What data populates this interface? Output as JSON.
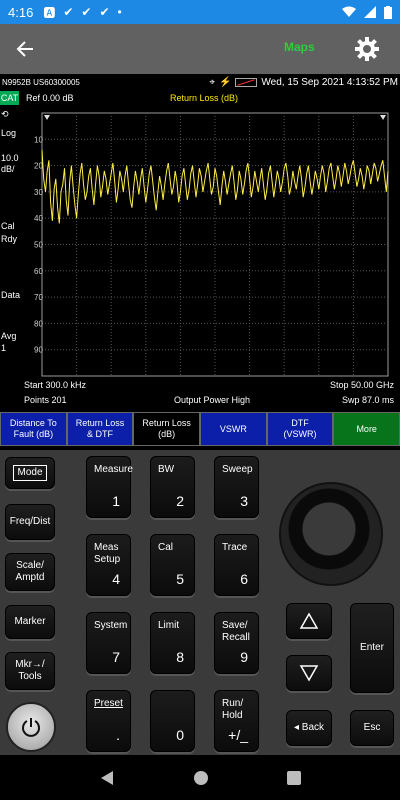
{
  "status_bar": {
    "time": "4:16",
    "icons": [
      "a-badge-icon",
      "check-icon",
      "check-icon",
      "check-icon",
      "dot-icon"
    ]
  },
  "app_bar": {
    "maps_label": "Maps"
  },
  "instrument": {
    "model": "N9952B US60300005",
    "datetime": "Wed, 15 Sep 2021 4:13:52 PM",
    "left": {
      "cat": "CAT",
      "log": "Log",
      "scale_value": "10.0",
      "scale_unit": "dB/",
      "cal": "Cal",
      "rdy": "Rdy",
      "data": "Data",
      "avg": "Avg",
      "avg_count": "1"
    },
    "ref_label": "Ref 0.00 dB",
    "trace_title": "Return Loss (dB)",
    "y_ticks": [
      "10",
      "20",
      "30",
      "40",
      "50",
      "60",
      "70",
      "80",
      "90"
    ],
    "start": "Start 300.0 kHz",
    "stop": "Stop 50.00 GHz",
    "points": "Points 201",
    "output_power": "Output Power High",
    "sweep_time": "Swp 87.0 ms"
  },
  "softkeys": [
    {
      "line1": "Distance To",
      "line2": "Fault (dB)"
    },
    {
      "line1": "Return Loss",
      "line2": "& DTF"
    },
    {
      "line1": "Return Loss",
      "line2": "(dB)"
    },
    {
      "line1": "VSWR",
      "line2": ""
    },
    {
      "line1": "DTF",
      "line2": "(VSWR)"
    },
    {
      "line1": "More",
      "line2": ""
    }
  ],
  "keys": {
    "mode": "Mode",
    "freq_dist": "Freq/Dist",
    "scale_amptd_1": "Scale/",
    "scale_amptd_2": "Amptd",
    "marker": "Marker",
    "mkr_tools_1": "Mkr→/",
    "mkr_tools_2": "Tools",
    "measure": "Measure",
    "bw": "BW",
    "sweep": "Sweep",
    "meas_setup_1": "Meas",
    "meas_setup_2": "Setup",
    "cal": "Cal",
    "trace": "Trace",
    "system": "System",
    "limit": "Limit",
    "save_recall_1": "Save/",
    "save_recall_2": "Recall",
    "preset": "Preset",
    "run_hold_1": "Run/",
    "run_hold_2": "Hold",
    "n1": "1",
    "n2": "2",
    "n3": "3",
    "n4": "4",
    "n5": "5",
    "n6": "6",
    "n7": "7",
    "n8": "8",
    "n9": "9",
    "n0": "0",
    "dot": ".",
    "plusminus": "+/_",
    "enter": "Enter",
    "back": "◂ Back",
    "esc": "Esc"
  },
  "trace_color": "#ffee44",
  "trace_db": [
    14,
    25,
    30,
    22,
    18,
    34,
    41,
    29,
    25,
    36,
    42,
    30,
    27,
    21,
    33,
    39,
    26,
    20,
    28,
    35,
    40,
    31,
    23,
    19,
    27,
    33,
    30,
    24,
    21,
    29,
    35,
    27,
    20,
    24,
    32,
    28,
    22,
    25,
    31,
    27,
    23,
    19,
    26,
    34,
    29,
    22,
    25,
    30,
    24,
    20,
    27,
    33,
    36,
    28,
    22,
    26,
    31,
    25,
    21,
    28,
    34,
    29,
    23,
    20,
    26,
    32,
    37,
    30,
    24,
    28,
    33,
    27,
    22,
    19,
    25,
    31,
    28,
    22,
    26,
    34,
    30,
    24,
    21,
    27,
    33,
    29,
    23,
    20,
    26,
    32,
    27,
    21,
    24,
    30,
    26,
    22,
    19,
    25,
    31,
    28,
    21,
    24,
    30,
    35,
    28,
    22,
    26,
    31,
    27,
    23,
    20,
    26,
    33,
    29,
    22,
    25,
    31,
    27,
    22,
    19,
    25,
    32,
    28,
    22,
    26,
    30,
    25,
    21,
    27,
    33,
    29,
    23,
    20,
    26,
    32,
    27,
    22,
    25,
    30,
    26,
    21,
    19,
    24,
    31,
    28,
    22,
    26,
    29,
    24,
    20,
    25,
    32,
    28,
    23,
    20,
    26,
    31,
    27,
    22,
    25,
    29,
    24,
    20,
    23,
    30,
    26,
    21,
    19,
    24,
    29,
    25,
    20,
    23,
    28,
    24,
    19,
    22,
    27,
    24,
    20,
    18,
    23,
    28,
    25,
    21,
    24,
    29,
    25,
    20,
    22,
    27,
    23,
    19,
    21,
    26,
    23,
    20,
    18,
    24,
    30,
    22
  ]
}
